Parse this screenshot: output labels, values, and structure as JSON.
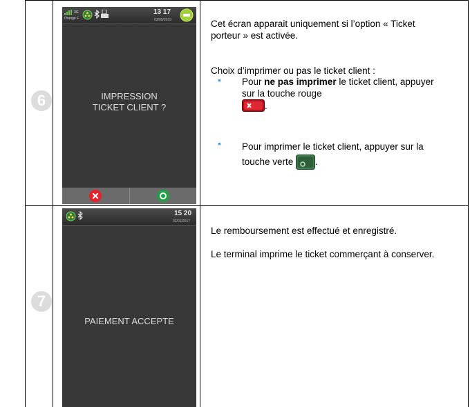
{
  "rows": [
    {
      "step": "6",
      "screen": {
        "operator": "Orange F",
        "network": "3G",
        "time": "13 17",
        "date": "03/09/2019",
        "lines": [
          "IMPRESSION",
          "TICKET CLIENT ?"
        ]
      },
      "desc": {
        "p1": "Cet écran apparait uniquement si l’option « Ticket porteur » est activée.",
        "p2": "Choix d’imprimer ou pas le ticket client :",
        "b1_pre": "Pour ",
        "b1_bold": "ne pas imprimer",
        "b1_post": " le ticket client, appuyer sur la touche rouge",
        "b1_end": ".",
        "b2": "Pour imprimer le ticket client, appuyer sur la touche verte",
        "b2_end": "."
      }
    },
    {
      "step": "7",
      "screen": {
        "time": "15 20",
        "date": "02/02/2017",
        "lines": [
          "PAIEMENT ACCEPTE"
        ]
      },
      "desc": {
        "p1": "Le remboursement est effectué et enregistré.",
        "p2": "Le terminal imprime le ticket commerçant à conserver."
      }
    }
  ],
  "colors": {
    "cancel": "#e8202a",
    "ok": "#1fa045",
    "bullet": "#3aa0e0"
  }
}
